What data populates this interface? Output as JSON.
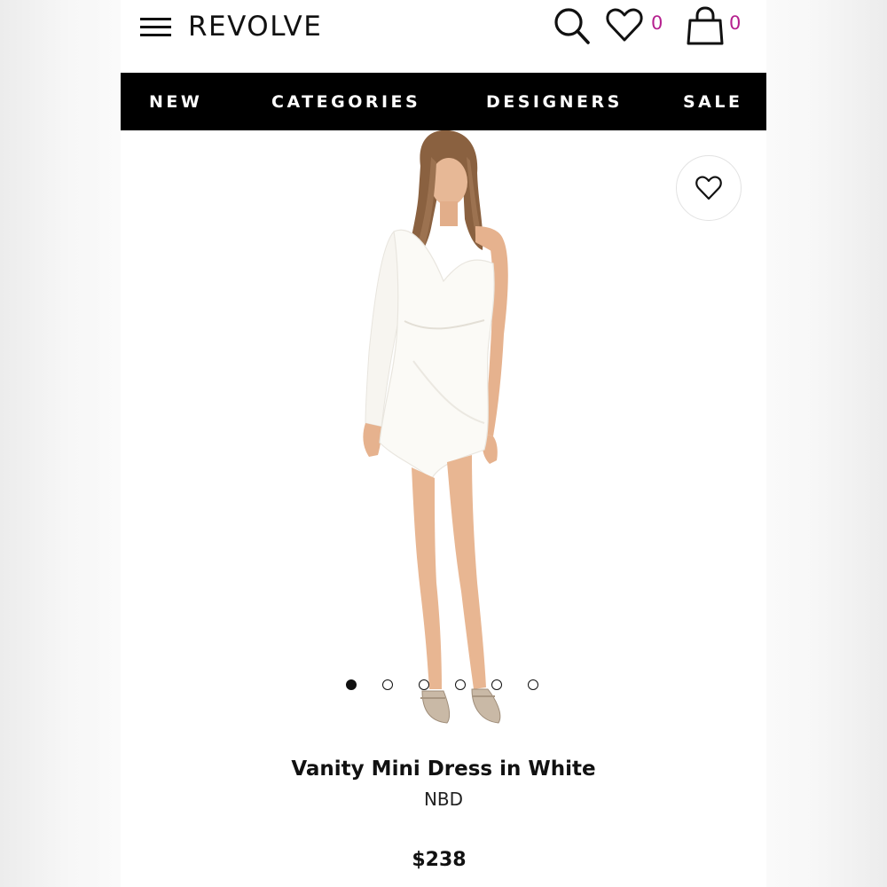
{
  "header": {
    "logo": "REVOLVE",
    "wishlist_count": "0",
    "bag_count": "0",
    "icons": [
      "menu-icon",
      "search-icon",
      "heart-icon",
      "shopping-bag-icon"
    ]
  },
  "nav": {
    "items": [
      "NEW",
      "CATEGORIES",
      "DESIGNERS",
      "SALE"
    ]
  },
  "carousel": {
    "slide_count": 6,
    "active_slide": 1
  },
  "product": {
    "name": "Vanity Mini Dress in White",
    "brand": "NBD",
    "price": "$238"
  },
  "colors": {
    "accent": "#b51f8e",
    "nav_background": "#000000",
    "text": "#111111"
  }
}
